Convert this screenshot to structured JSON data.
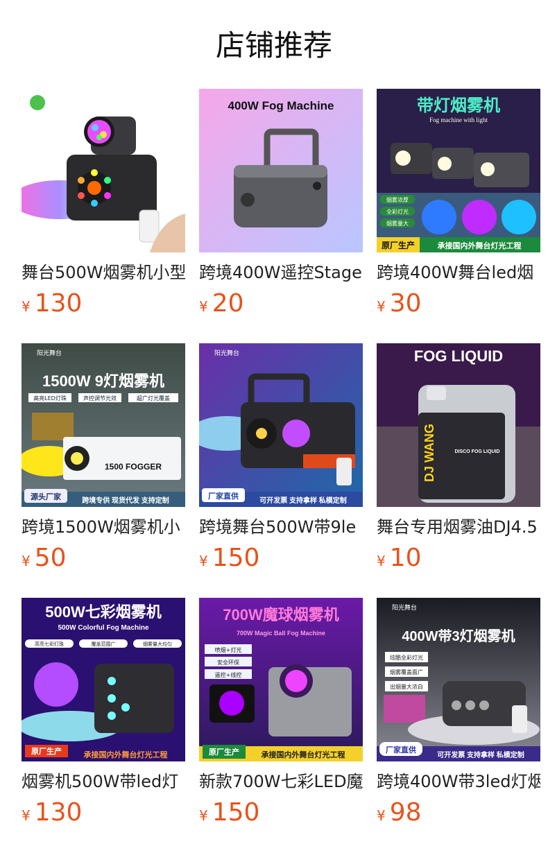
{
  "section": {
    "title": "店铺推荐"
  },
  "currency": "¥",
  "products": [
    {
      "name": "舞台500W烟雾机小型",
      "price": "130",
      "image": {
        "overlay_title": "",
        "overlay_sub": "",
        "tags": [],
        "footer_left": "",
        "footer_right": "",
        "corner": ""
      }
    },
    {
      "name": "跨境400W遥控Stage",
      "price": "20",
      "image": {
        "overlay_title": "400W Fog Machine",
        "overlay_sub": "",
        "tags": [],
        "footer_left": "",
        "footer_right": "",
        "corner": ""
      }
    },
    {
      "name": "跨境400W舞台led烟",
      "price": "30",
      "image": {
        "overlay_title": "带灯烟雾机",
        "overlay_sub": "Fog machine with light",
        "tags": [
          "烟雾浓厚",
          "全彩灯光",
          "烟雾量大"
        ],
        "footer_left": "原厂生产",
        "footer_right": "承接国内外舞台灯光工程",
        "corner": ""
      }
    },
    {
      "name": "跨境1500W烟雾机小",
      "price": "50",
      "image": {
        "overlay_title": "1500W 9灯烟雾机",
        "overlay_sub": "",
        "tags": [
          "高亮LED灯珠",
          "声控调节光效",
          "超广灯光覆盖"
        ],
        "footer_left": "源头厂家",
        "footer_right": "跨境专供  现货代发  支持定制",
        "corner": "阳光舞台",
        "label": "1500 FOGGER"
      }
    },
    {
      "name": "跨境舞台500W带9le",
      "price": "150",
      "image": {
        "overlay_title": "",
        "overlay_sub": "",
        "tags": [],
        "footer_left": "厂家直供",
        "footer_right": "可开发票  支持拿样  私模定制",
        "corner": "阳光舞台"
      }
    },
    {
      "name": "舞台专用烟雾油DJ4.5",
      "price": "10",
      "image": {
        "overlay_title": "FOG LIQUID",
        "overlay_sub": "",
        "tags": [],
        "footer_left": "",
        "footer_right": "",
        "corner": "",
        "label": "DJ WANG",
        "label2": "DISCO FOG LIQUID"
      }
    },
    {
      "name": "烟雾机500W带led灯",
      "price": "130",
      "image": {
        "overlay_title": "500W七彩烟雾机",
        "overlay_sub": "500W Colorful Fog Machine",
        "tags": [
          "高亮七彩灯珠",
          "覆盖范围广",
          "烟雾量大均匀"
        ],
        "footer_left": "原厂生产",
        "footer_right": "承接国内外舞台灯光工程",
        "corner": ""
      }
    },
    {
      "name": "新款700W七彩LED魔",
      "price": "150",
      "image": {
        "overlay_title": "700W魔球烟雾机",
        "overlay_sub": "700W Magic Ball Fog Machine",
        "tags": [
          "喷烟+灯光",
          "安全环保",
          "遥控+线控"
        ],
        "footer_left": "原厂生产",
        "footer_right": "承接国内外舞台灯光工程",
        "corner": ""
      }
    },
    {
      "name": "跨境400W带3led灯烟",
      "price": "98",
      "image": {
        "overlay_title": "400W带3灯烟雾机",
        "overlay_sub": "",
        "tags": [
          "炫酷全彩灯光",
          "烟雾覆盖面广",
          "出烟量大浓白"
        ],
        "footer_left": "厂家直供",
        "footer_right": "可开发票  支持拿样  私模定制",
        "corner": "阳光舞台"
      }
    }
  ]
}
